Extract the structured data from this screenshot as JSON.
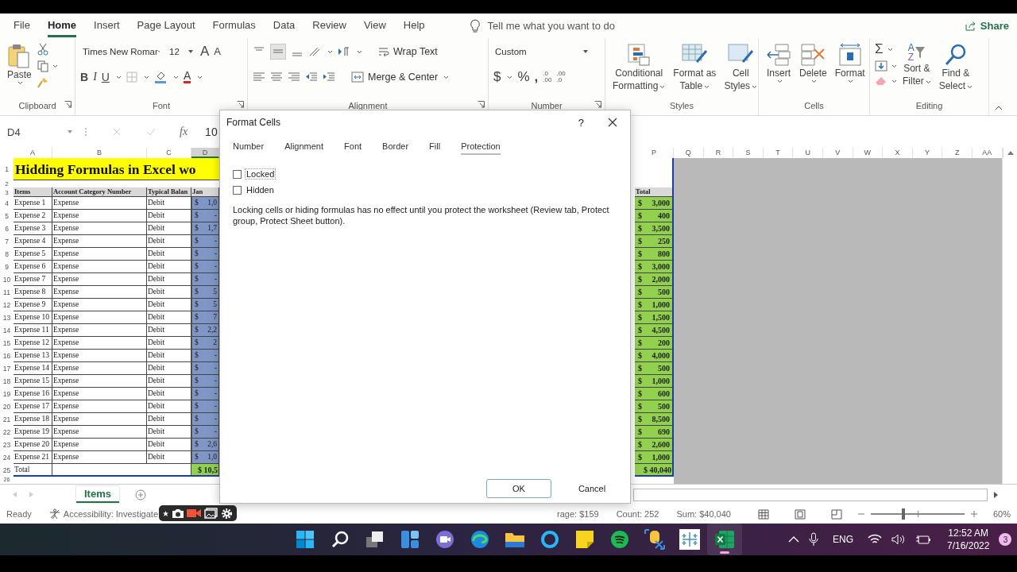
{
  "ribbon_tabs": [
    {
      "label": "File",
      "selected": false
    },
    {
      "label": "Home",
      "selected": true
    },
    {
      "label": "Insert",
      "selected": false
    },
    {
      "label": "Page Layout",
      "selected": false
    },
    {
      "label": "Formulas",
      "selected": false
    },
    {
      "label": "Data",
      "selected": false
    },
    {
      "label": "Review",
      "selected": false
    },
    {
      "label": "View",
      "selected": false
    },
    {
      "label": "Help",
      "selected": false
    }
  ],
  "tell_me": "Tell me what you want to do",
  "share": "Share",
  "clipboard": {
    "paste": "Paste",
    "label": "Clipboard"
  },
  "font": {
    "name": "Times New Romar",
    "size": "12",
    "grow": "A",
    "shrink": "A",
    "bold": "B",
    "italic": "I",
    "underline": "U",
    "color_letter": "A",
    "label": "Font"
  },
  "alignment": {
    "wrap": "Wrap Text",
    "merge": "Merge & Center",
    "label": "Alignment"
  },
  "number": {
    "format": "Custom",
    "currency": "$",
    "percent": "%",
    "comma": ",",
    "increase_decimal": [
      ".0",
      ".00"
    ],
    "decrease_decimal": [
      ".00",
      ".0"
    ],
    "label": "Number"
  },
  "styles": {
    "buttons": [
      {
        "kind": "conditional",
        "lines": [
          "Conditional",
          "Formatting"
        ]
      },
      {
        "kind": "table",
        "lines": [
          "Format as",
          "Table"
        ]
      },
      {
        "kind": "cell",
        "lines": [
          "Cell",
          "Styles"
        ]
      }
    ],
    "label": "Styles"
  },
  "cells": {
    "buttons": [
      {
        "kind": "insert",
        "label": "Insert"
      },
      {
        "kind": "delete",
        "label": "Delete"
      },
      {
        "kind": "format",
        "label": "Format"
      }
    ],
    "label": "Cells"
  },
  "editing": {
    "sum": "Σ",
    "sort": [
      "Sort &",
      "Filter"
    ],
    "sort_letters": [
      "A",
      "Z"
    ],
    "find": [
      "Find &",
      "Select"
    ],
    "label": "Editing"
  },
  "formula_bar": {
    "name_box": "D4",
    "fx": "fx",
    "value": "10"
  },
  "sheet": {
    "columns_left": [
      {
        "label": "A",
        "selected": false
      },
      {
        "label": "B",
        "selected": false
      },
      {
        "label": "C",
        "selected": false
      },
      {
        "label": "D",
        "selected": true
      }
    ],
    "columns_right": [
      {
        "label": "P",
        "selected": false
      },
      {
        "label": "Q",
        "selected": false
      },
      {
        "label": "R",
        "selected": false
      },
      {
        "label": "S",
        "selected": false
      },
      {
        "label": "T",
        "selected": false
      },
      {
        "label": "U",
        "selected": false
      },
      {
        "label": "V",
        "selected": false
      },
      {
        "label": "W",
        "selected": false
      },
      {
        "label": "X",
        "selected": false
      },
      {
        "label": "Y",
        "selected": false
      },
      {
        "label": "Z",
        "selected": false
      },
      {
        "label": "AA",
        "selected": false
      }
    ],
    "title_row": {
      "num": "1",
      "text": "Hidding Formulas in Excel wo"
    },
    "blank_row": {
      "num": "2"
    },
    "header_row": {
      "num": "3",
      "cells": [
        "Items",
        "Account Category Number",
        "Typical Balan",
        "Jan"
      ],
      "total": "Total"
    },
    "rows": [
      {
        "num": "4",
        "item": "Expense 1",
        "category": "Expense",
        "balance": "Debit",
        "jan_currency": "$",
        "jan": "1,0",
        "total_currency": "$",
        "total": "3,000"
      },
      {
        "num": "5",
        "item": "Expense 2",
        "category": "Expense",
        "balance": "Debit",
        "jan_currency": "$",
        "jan": "-",
        "total_currency": "$",
        "total": "400"
      },
      {
        "num": "6",
        "item": "Expense 3",
        "category": "Expense",
        "balance": "Debit",
        "jan_currency": "$",
        "jan": "1,7",
        "total_currency": "$",
        "total": "3,500"
      },
      {
        "num": "7",
        "item": "Expense 4",
        "category": "Expense",
        "balance": "Debit",
        "jan_currency": "$",
        "jan": "-",
        "total_currency": "$",
        "total": "250"
      },
      {
        "num": "8",
        "item": "Expense 5",
        "category": "Expense",
        "balance": "Debit",
        "jan_currency": "$",
        "jan": "-",
        "total_currency": "$",
        "total": "800"
      },
      {
        "num": "9",
        "item": "Expense 6",
        "category": "Expense",
        "balance": "Debit",
        "jan_currency": "$",
        "jan": "-",
        "total_currency": "$",
        "total": "3,000"
      },
      {
        "num": "10",
        "item": "Expense 7",
        "category": "Expense",
        "balance": "Debit",
        "jan_currency": "$",
        "jan": "-",
        "total_currency": "$",
        "total": "2,000"
      },
      {
        "num": "11",
        "item": "Expense 8",
        "category": "Expense",
        "balance": "Debit",
        "jan_currency": "$",
        "jan": "5",
        "total_currency": "$",
        "total": "500"
      },
      {
        "num": "12",
        "item": "Expense 9",
        "category": "Expense",
        "balance": "Debit",
        "jan_currency": "$",
        "jan": "5",
        "total_currency": "$",
        "total": "1,000"
      },
      {
        "num": "13",
        "item": "Expense 10",
        "category": "Expense",
        "balance": "Debit",
        "jan_currency": "$",
        "jan": "7",
        "total_currency": "$",
        "total": "1,500"
      },
      {
        "num": "14",
        "item": "Expense 11",
        "category": "Expense",
        "balance": "Debit",
        "jan_currency": "$",
        "jan": "2,2",
        "total_currency": "$",
        "total": "4,500"
      },
      {
        "num": "15",
        "item": "Expense 12",
        "category": "Expense",
        "balance": "Debit",
        "jan_currency": "$",
        "jan": "2",
        "total_currency": "$",
        "total": "200"
      },
      {
        "num": "16",
        "item": "Expense 13",
        "category": "Expense",
        "balance": "Debit",
        "jan_currency": "$",
        "jan": "-",
        "total_currency": "$",
        "total": "4,000"
      },
      {
        "num": "17",
        "item": "Expense 14",
        "category": "Expense",
        "balance": "Debit",
        "jan_currency": "$",
        "jan": "-",
        "total_currency": "$",
        "total": "500"
      },
      {
        "num": "18",
        "item": "Expense 15",
        "category": "Expense",
        "balance": "Debit",
        "jan_currency": "$",
        "jan": "-",
        "total_currency": "$",
        "total": "1,000"
      },
      {
        "num": "19",
        "item": "Expense 16",
        "category": "Expense",
        "balance": "Debit",
        "jan_currency": "$",
        "jan": "-",
        "total_currency": "$",
        "total": "600"
      },
      {
        "num": "20",
        "item": "Expense 17",
        "category": "Expense",
        "balance": "Debit",
        "jan_currency": "$",
        "jan": "-",
        "total_currency": "$",
        "total": "500"
      },
      {
        "num": "21",
        "item": "Expense 18",
        "category": "Expense",
        "balance": "Debit",
        "jan_currency": "$",
        "jan": "-",
        "total_currency": "$",
        "total": "8,500"
      },
      {
        "num": "22",
        "item": "Expense 19",
        "category": "Expense",
        "balance": "Debit",
        "jan_currency": "$",
        "jan": "-",
        "total_currency": "$",
        "total": "690"
      },
      {
        "num": "23",
        "item": "Expense 20",
        "category": "Expense",
        "balance": "Debit",
        "jan_currency": "$",
        "jan": "2,6",
        "total_currency": "$",
        "total": "2,600"
      },
      {
        "num": "24",
        "item": "Expense 21",
        "category": "Expense",
        "balance": "Debit",
        "jan_currency": "$",
        "jan": "1,0",
        "total_currency": "$",
        "total": "1,000"
      }
    ],
    "total_row": {
      "num": "25",
      "label": "Total",
      "jan": "$ 10,5",
      "total": "$ 40,040"
    },
    "cut_row": {
      "num": "26"
    }
  },
  "dialog": {
    "title": "Format Cells",
    "help": "?",
    "tabs": [
      {
        "label": "Number",
        "selected": false
      },
      {
        "label": "Alignment",
        "selected": false
      },
      {
        "label": "Font",
        "selected": false
      },
      {
        "label": "Border",
        "selected": false
      },
      {
        "label": "Fill",
        "selected": false
      },
      {
        "label": "Protection",
        "selected": true
      }
    ],
    "options": [
      {
        "label": "Locked",
        "checked": false
      },
      {
        "label": "Hidden",
        "checked": false
      }
    ],
    "note": "Locking cells or hiding formulas has no effect until you protect the worksheet (Review tab, Protect group, Protect Sheet button).",
    "buttons": [
      {
        "label": "OK",
        "kind": "primary"
      },
      {
        "label": "Cancel",
        "kind": "secondary"
      }
    ]
  },
  "sheet_tabs": [
    {
      "label": "Items",
      "selected": true
    }
  ],
  "status": {
    "ready": "Ready",
    "accessibility": "Accessibility: Investigate",
    "average": "rage: $159",
    "count": "Count: 252",
    "sum": "Sum:  $40,040",
    "zoom": "60%",
    "level": 0.35
  },
  "taskbar": {
    "apps": [
      {
        "kind": "start",
        "selected": false
      },
      {
        "kind": "search",
        "selected": false
      },
      {
        "kind": "taskview",
        "selected": false
      },
      {
        "kind": "widgets",
        "selected": false
      },
      {
        "kind": "chat",
        "selected": false
      },
      {
        "kind": "edge",
        "selected": false
      },
      {
        "kind": "folder",
        "selected": false
      },
      {
        "kind": "cortana",
        "selected": false
      },
      {
        "kind": "notes",
        "selected": false
      },
      {
        "kind": "spotify",
        "selected": false
      },
      {
        "kind": "database",
        "selected": false
      },
      {
        "kind": "tableau",
        "selected": false
      },
      {
        "kind": "excel",
        "selected": true
      }
    ],
    "language": "ENG",
    "time": "12:52 AM",
    "date": "7/16/2022",
    "notifications": "3"
  }
}
